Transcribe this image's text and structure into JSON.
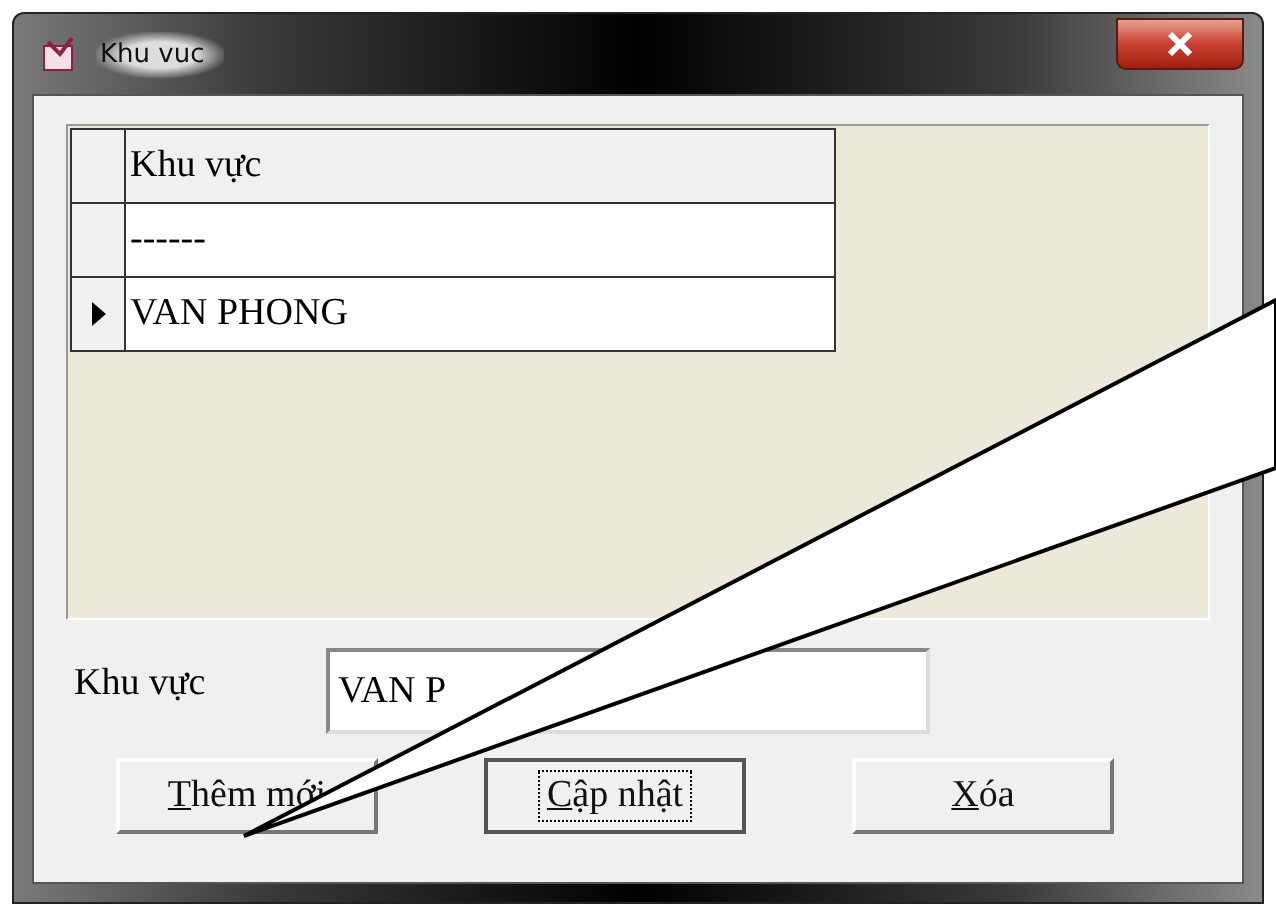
{
  "window": {
    "title": "Khu vuc"
  },
  "grid": {
    "columns": [
      "Khu vực"
    ],
    "rows": [
      {
        "cells": [
          "------"
        ],
        "selected": false
      },
      {
        "cells": [
          "VAN PHONG"
        ],
        "selected": true
      }
    ]
  },
  "field": {
    "label": "Khu vực",
    "value": "VAN P"
  },
  "buttons": [
    {
      "label": "Thêm mới",
      "mnemonic": true,
      "focused": false
    },
    {
      "label": "Cập nhật",
      "mnemonic": true,
      "focused": true
    },
    {
      "label": "Xóa",
      "mnemonic": true,
      "focused": false
    }
  ]
}
